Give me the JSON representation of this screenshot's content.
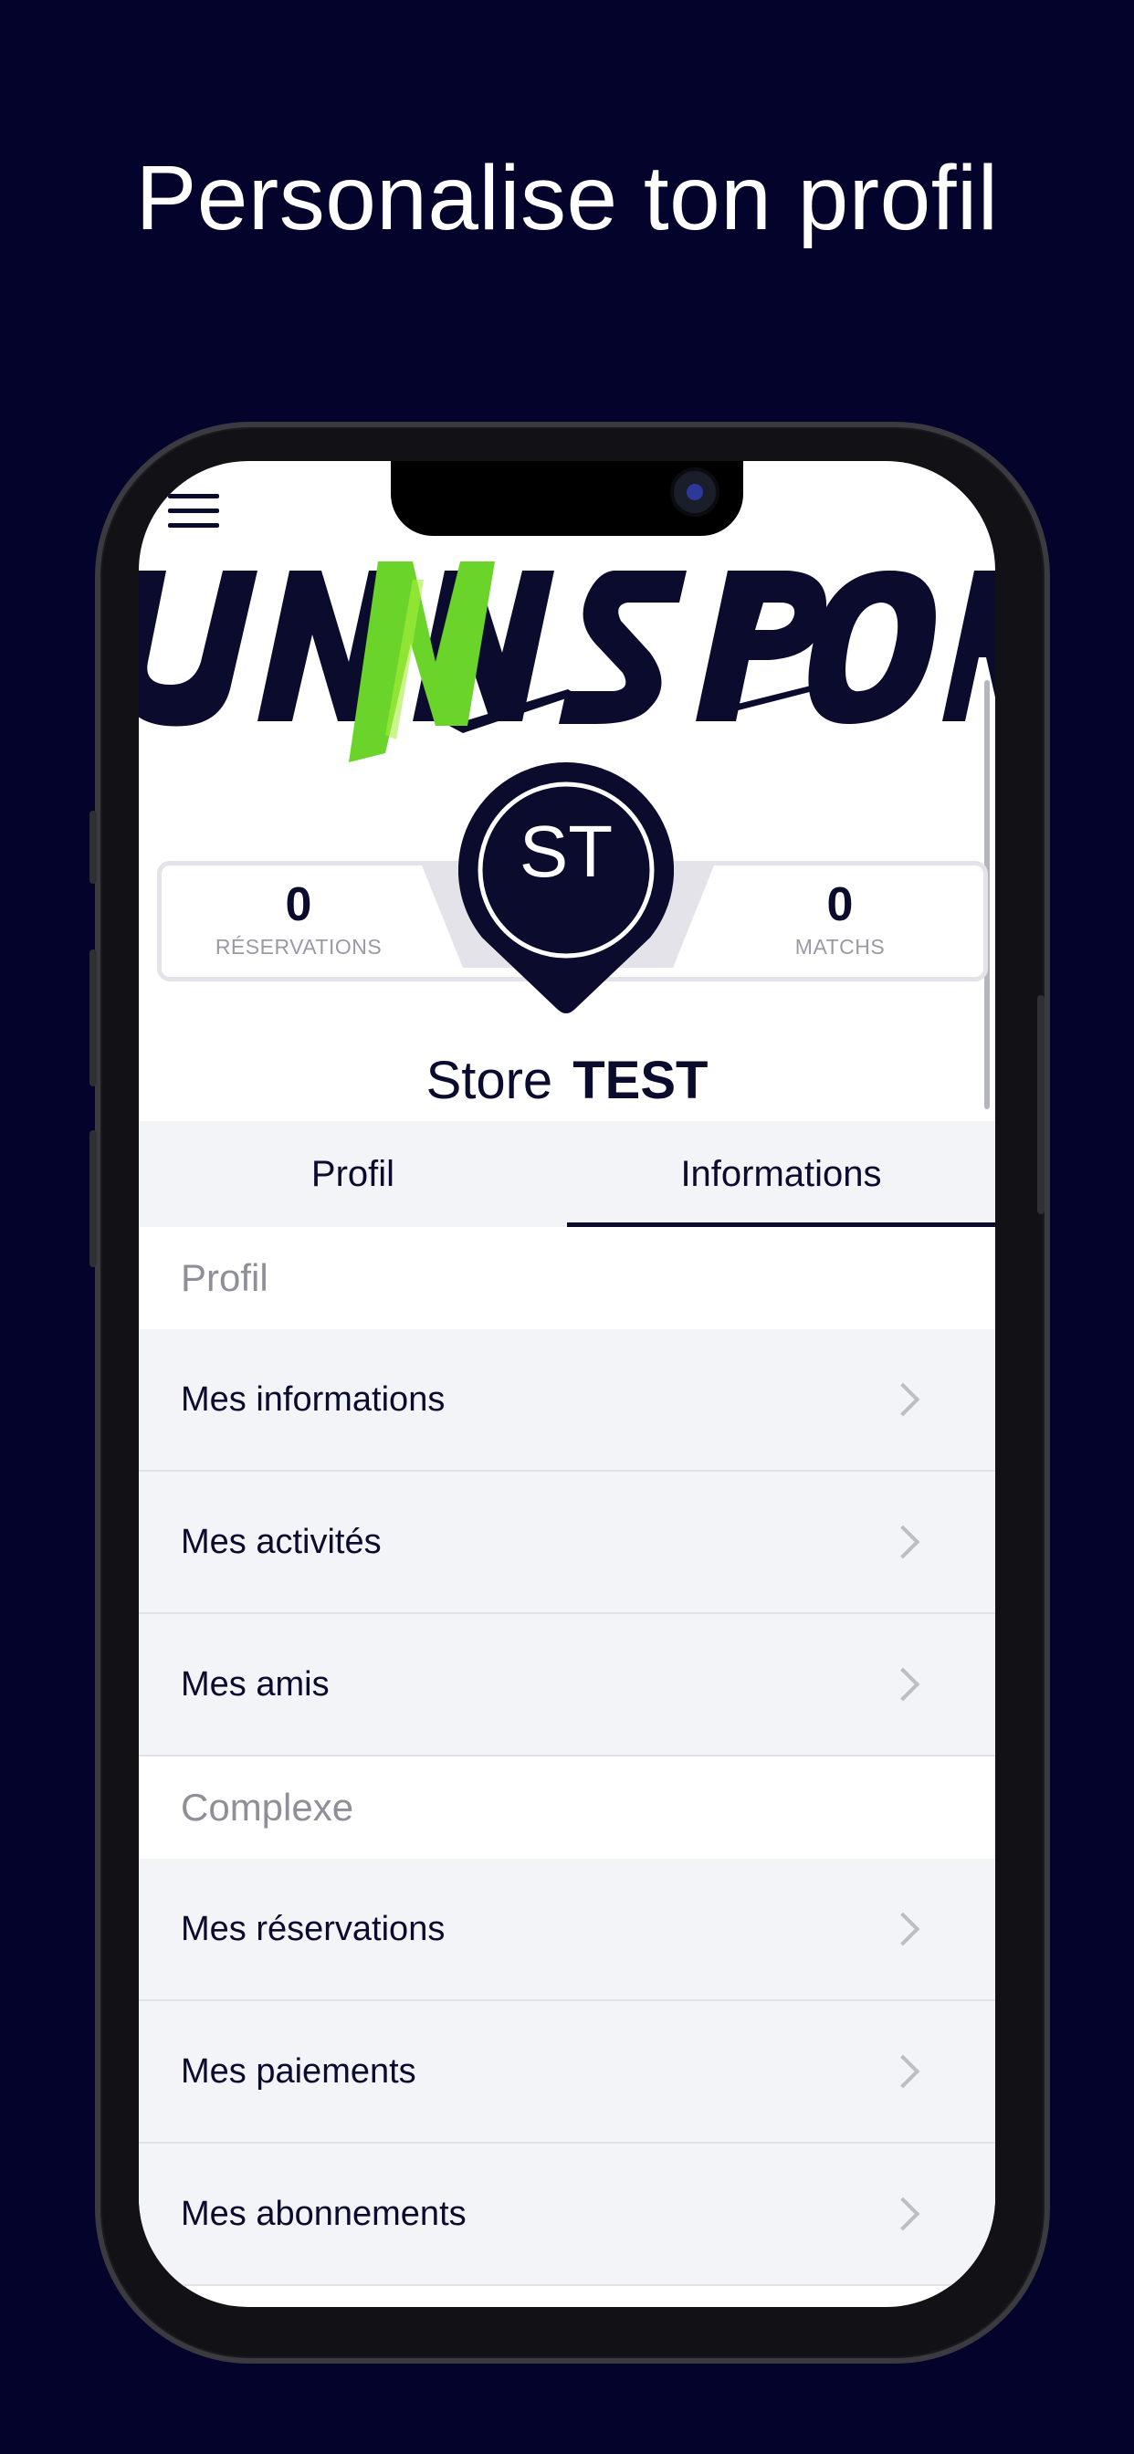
{
  "headline": "Personalise ton profil",
  "app": {
    "logo_text": "UNNSPORT",
    "colors": {
      "navy": "#0b0b2e",
      "green": "#6ad42a",
      "background": "#03032c"
    },
    "stats": {
      "reservations": {
        "value": "0",
        "label": "RÉSERVATIONS"
      },
      "matchs": {
        "value": "0",
        "label": "MATCHS"
      }
    },
    "avatar_initials": "ST",
    "user": {
      "first_name": "Store",
      "last_name": "TEST"
    },
    "tabs": [
      {
        "label": "Profil",
        "active": false
      },
      {
        "label": "Informations",
        "active": true
      }
    ],
    "sections": [
      {
        "title": "Profil",
        "items": [
          "Mes informations",
          "Mes activités",
          "Mes amis"
        ]
      },
      {
        "title": "Complexe",
        "items": [
          "Mes réservations",
          "Mes paiements",
          "Mes abonnements"
        ]
      }
    ]
  }
}
